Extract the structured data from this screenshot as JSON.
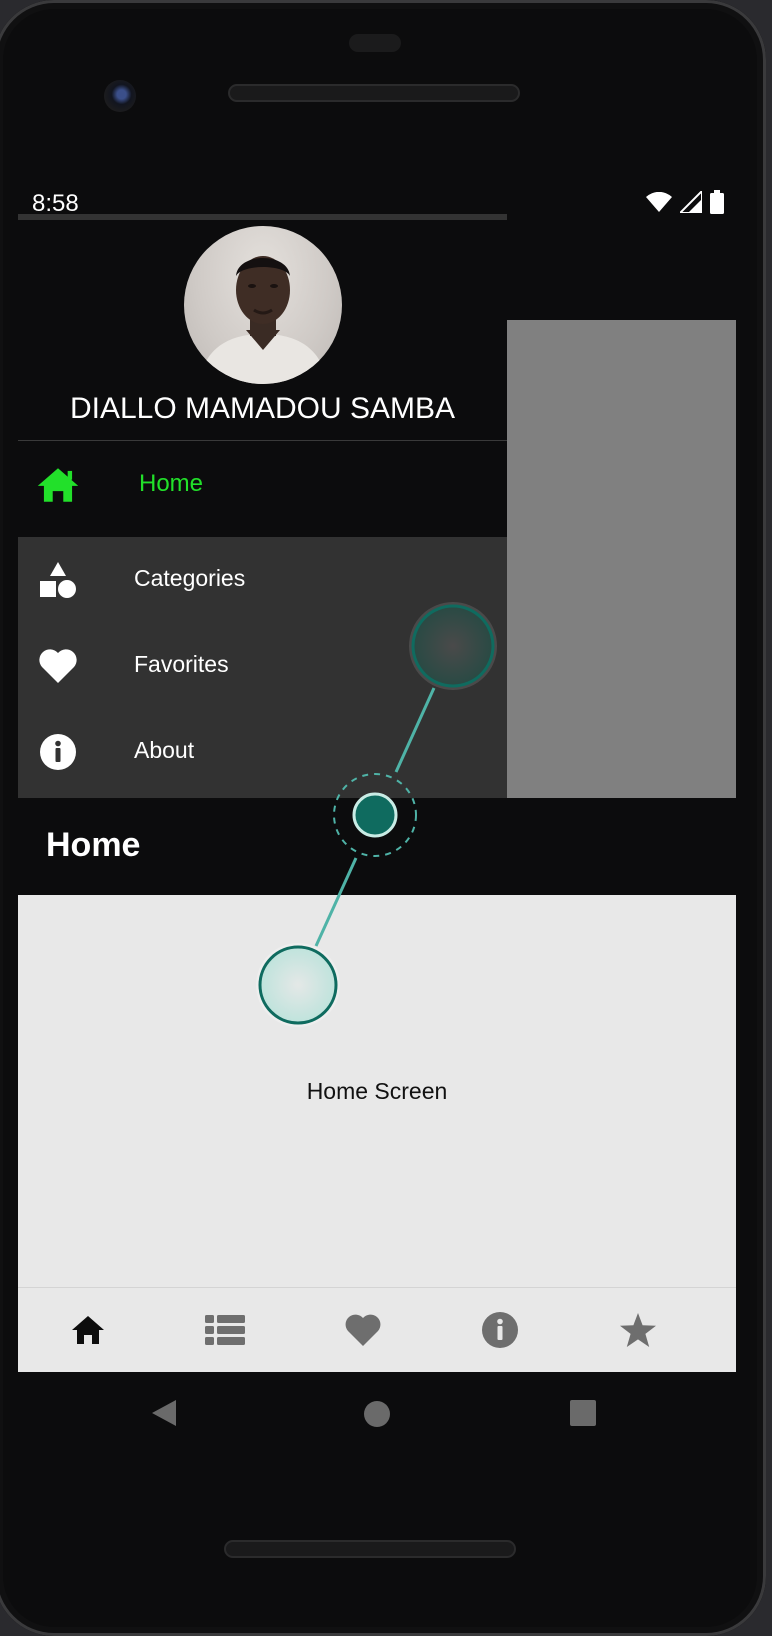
{
  "status_bar": {
    "time": "8:58"
  },
  "drawer": {
    "user_name": "DIALLO MAMADOU SAMBA",
    "items": [
      {
        "label": "Home",
        "icon": "home-icon",
        "active": true
      },
      {
        "label": "Categories",
        "icon": "shapes-icon",
        "active": false
      },
      {
        "label": "Favorites",
        "icon": "heart-icon",
        "active": false
      },
      {
        "label": "About",
        "icon": "info-icon",
        "active": false
      }
    ]
  },
  "app_bar": {
    "title": "Home"
  },
  "main": {
    "text": "Home Screen"
  },
  "bottom_nav": {
    "items": [
      "home-icon",
      "list-icon",
      "heart-icon",
      "info-icon",
      "star-icon"
    ],
    "active": "home-icon"
  },
  "colors": {
    "accent_active": "#22e02a",
    "drawer_bg": "#323232",
    "scrim": "#808080",
    "content_bg": "#e8e8e8",
    "gesture_marker": "#0f6b5f"
  }
}
